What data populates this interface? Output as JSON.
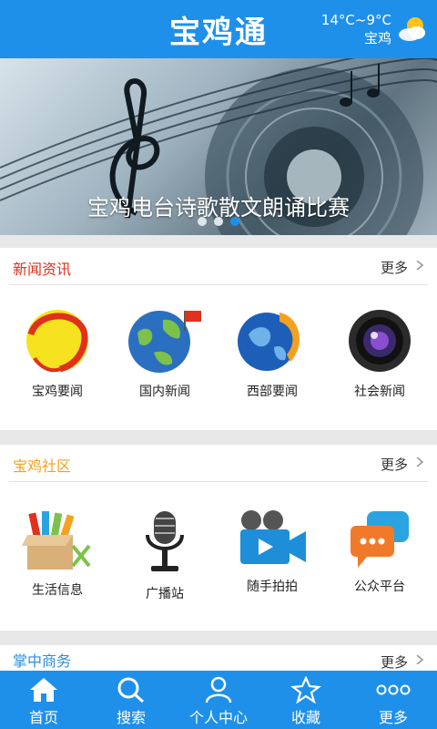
{
  "header": {
    "title": "宝鸡通",
    "weather": {
      "temp": "14°C~9°C",
      "city": "宝鸡",
      "icon": "cloudy-sun-icon"
    }
  },
  "banner": {
    "caption": "宝鸡电台诗歌散文朗诵比赛",
    "slides": 3,
    "active_slide": 3
  },
  "sections": [
    {
      "title": "新闻资讯",
      "title_color": "#e0301e",
      "more": "更多",
      "items": [
        {
          "label": "宝鸡要闻",
          "icon": "red-ring-news-icon"
        },
        {
          "label": "国内新闻",
          "icon": "globe-flag-icon"
        },
        {
          "label": "西部要闻",
          "icon": "globe-arrow-icon"
        },
        {
          "label": "社会新闻",
          "icon": "camera-lens-icon"
        }
      ]
    },
    {
      "title": "宝鸡社区",
      "title_color": "#f5a01f",
      "more": "更多",
      "items": [
        {
          "label": "生活信息",
          "icon": "toolbox-icon"
        },
        {
          "label": "广播站",
          "icon": "microphone-icon"
        },
        {
          "label": "随手拍拍",
          "icon": "video-camera-icon"
        },
        {
          "label": "公众平台",
          "icon": "chat-bubbles-icon"
        }
      ]
    },
    {
      "title": "掌中商务",
      "title_color": "#2a8fe0",
      "more": "更多"
    }
  ],
  "tabbar": [
    {
      "label": "首页",
      "icon": "home-icon"
    },
    {
      "label": "搜索",
      "icon": "search-icon"
    },
    {
      "label": "个人中心",
      "icon": "user-icon"
    },
    {
      "label": "收藏",
      "icon": "star-icon"
    },
    {
      "label": "更多",
      "icon": "more-dots-icon"
    }
  ],
  "colors": {
    "primary": "#1e90ea"
  }
}
